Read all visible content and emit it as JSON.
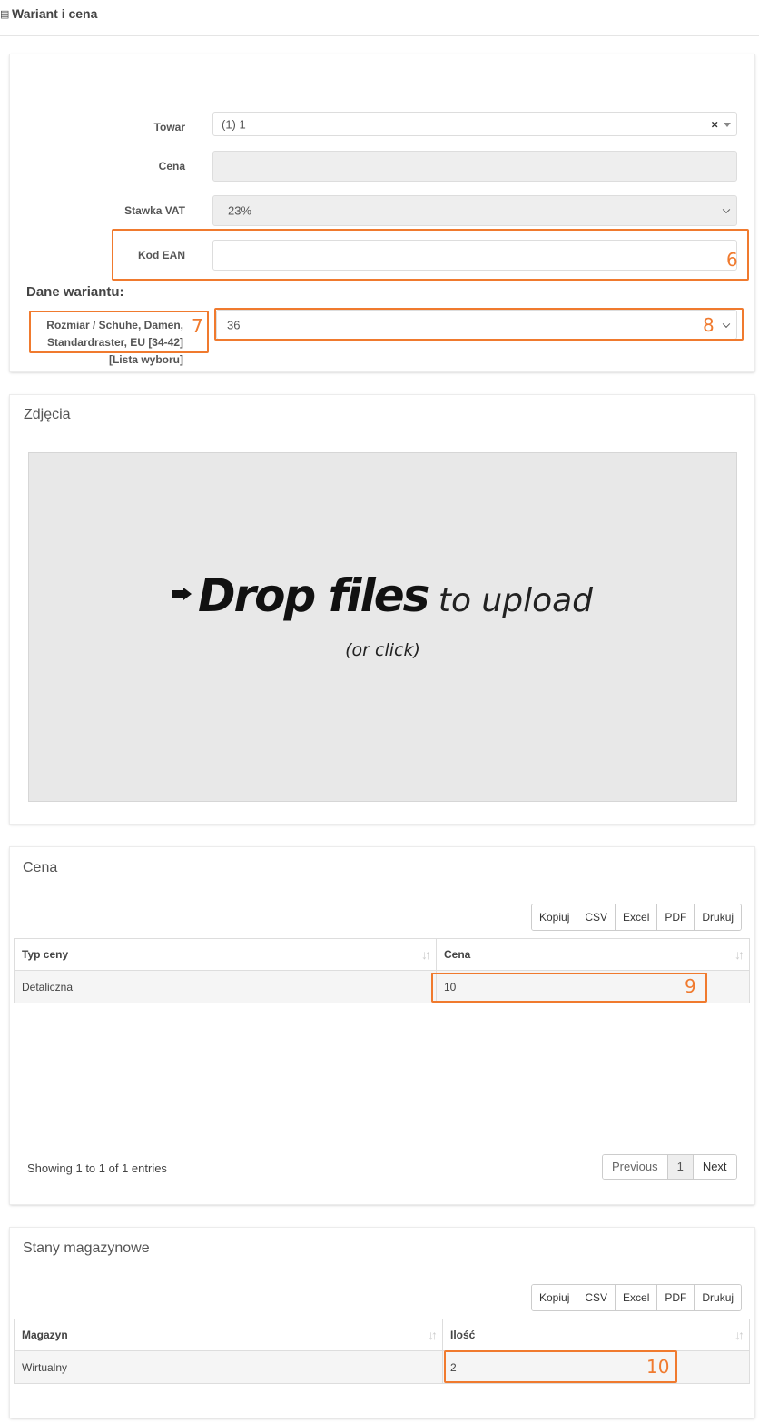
{
  "header": {
    "icon": "list-icon",
    "title": "Wariant i cena"
  },
  "form": {
    "towar": {
      "label": "Towar",
      "value": "(1) 1",
      "clear": "×"
    },
    "cena": {
      "label": "Cena",
      "value": ""
    },
    "vat": {
      "label": "Stawka VAT",
      "value": "23%"
    },
    "ean": {
      "label": "Kod EAN",
      "value": ""
    },
    "variant_heading": "Dane wariantu:",
    "rozmiar": {
      "label_line1": "Rozmiar / Schuhe, Damen,",
      "label_line2": "Standardraster, EU [34-42]",
      "label_line3": "[Lista wyboru]",
      "value": "36"
    }
  },
  "annotations": {
    "a6": "6",
    "a7": "7",
    "a8": "8",
    "a9": "9",
    "a10": "10"
  },
  "photos": {
    "title": "Zdjęcia",
    "drop_strong": "Drop files",
    "drop_light": " to upload",
    "drop_sub": "(or click)"
  },
  "price": {
    "title": "Cena",
    "buttons": [
      "Kopiuj",
      "CSV",
      "Excel",
      "PDF",
      "Drukuj"
    ],
    "columns": [
      "Typ ceny",
      "Cena"
    ],
    "rows": [
      [
        "Detaliczna",
        "10"
      ]
    ],
    "info": "Showing 1 to 1 of 1 entries",
    "pagination": {
      "prev": "Previous",
      "page": "1",
      "next": "Next"
    }
  },
  "stock": {
    "title": "Stany magazynowe",
    "buttons": [
      "Kopiuj",
      "CSV",
      "Excel",
      "PDF",
      "Drukuj"
    ],
    "columns": [
      "Magazyn",
      "Ilość"
    ],
    "rows": [
      [
        "Wirtualny",
        "2"
      ]
    ]
  },
  "colors": {
    "annotation": "#f07a2e"
  }
}
